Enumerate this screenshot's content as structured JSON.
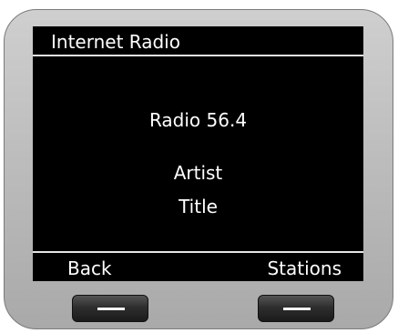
{
  "screen": {
    "title": "Internet Radio",
    "station": "Radio 56.4",
    "artist": "Artist",
    "track_title": "Title"
  },
  "softkeys": {
    "left_label": "Back",
    "right_label": "Stations"
  },
  "colors": {
    "screen_background": "#000000",
    "text": "#ffffff",
    "frame": "#bfbfbf"
  }
}
